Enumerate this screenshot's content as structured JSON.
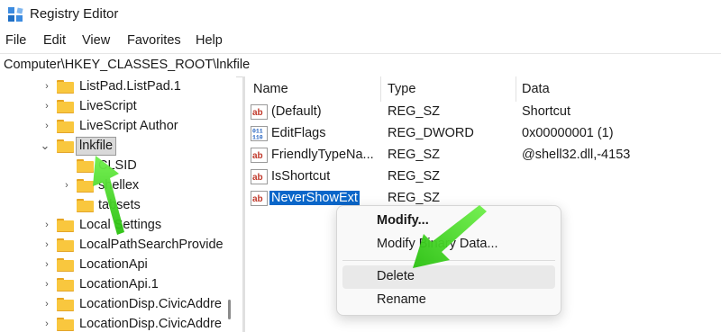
{
  "window": {
    "title": "Registry Editor",
    "icon": "registry-app-icon"
  },
  "menu": [
    "File",
    "Edit",
    "View",
    "Favorites",
    "Help"
  ],
  "address": "Computer\\HKEY_CLASSES_ROOT\\lnkfile",
  "tree": [
    {
      "label": "ListPad.ListPad.1",
      "expanded": false
    },
    {
      "label": "LiveScript",
      "expanded": false
    },
    {
      "label": "LiveScript Author",
      "expanded": false
    },
    {
      "label": "lnkfile",
      "expanded": true,
      "selected": true
    },
    {
      "label": "CLSID",
      "child": true,
      "expanded": false
    },
    {
      "label": "shellex",
      "child": true,
      "expanded": false
    },
    {
      "label": "tabsets",
      "child": true,
      "expanded": false
    },
    {
      "label": "Local Settings",
      "expanded": false
    },
    {
      "label": "LocalPathSearchProvide",
      "expanded": false
    },
    {
      "label": "LocationApi",
      "expanded": false
    },
    {
      "label": "LocationApi.1",
      "expanded": false
    },
    {
      "label": "LocationDisp.CivicAddre",
      "expanded": false
    },
    {
      "label": "LocationDisp.CivicAddre",
      "expanded": false
    }
  ],
  "columns": {
    "name": "Name",
    "type": "Type",
    "data": "Data"
  },
  "values": [
    {
      "name": "(Default)",
      "type": "REG_SZ",
      "data": "Shortcut",
      "icon": "string-value-icon"
    },
    {
      "name": "EditFlags",
      "type": "REG_DWORD",
      "data": "0x00000001 (1)",
      "icon": "binary-value-icon"
    },
    {
      "name": "FriendlyTypeNa...",
      "type": "REG_SZ",
      "data": "@shell32.dll,-4153",
      "icon": "string-value-icon"
    },
    {
      "name": "IsShortcut",
      "type": "REG_SZ",
      "data": "",
      "icon": "string-value-icon"
    },
    {
      "name": "NeverShowExt",
      "type": "REG_SZ",
      "data": "",
      "icon": "string-value-icon",
      "selected": true
    }
  ],
  "context_menu": {
    "items": [
      "Modify...",
      "Modify Binary Data...",
      "Delete",
      "Rename"
    ],
    "hovered": "Delete"
  },
  "colors": {
    "selection": "#0a66c9",
    "annotation_arrow": "#3ddc1c",
    "folder": "#f9c73e"
  }
}
